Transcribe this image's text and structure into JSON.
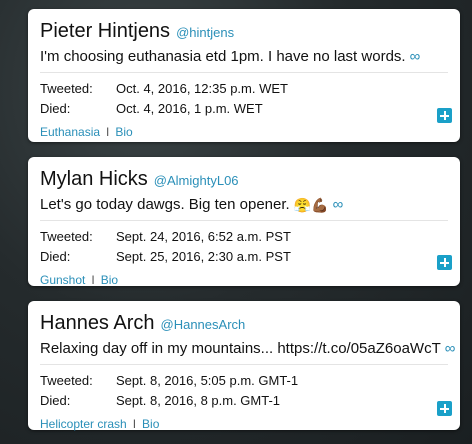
{
  "cards": [
    {
      "name": "Pieter Hintjens",
      "handle": "@hintjens",
      "tweet": "I'm choosing euthanasia etd 1pm. I have no last words.",
      "tweet_icon": "infinity-link-icon",
      "tweeted_label": "Tweeted:",
      "tweeted_value": "Oct. 4, 2016, 12:35 p.m. WET",
      "died_label": "Died:",
      "died_value": "Oct. 4, 2016, 1 p.m. WET",
      "cause": "Euthanasia",
      "separator": "I",
      "bio": "Bio"
    },
    {
      "name": "Mylan Hicks",
      "handle": "@AlmightyL06",
      "tweet": "Let's go today dawgs. Big ten opener.",
      "tweet_emoji": "😤💪🏾",
      "tweet_icon": "infinity-link-icon",
      "tweeted_label": "Tweeted:",
      "tweeted_value": "Sept. 24, 2016, 6:52 a.m. PST",
      "died_label": "Died:",
      "died_value": "Sept. 25, 2016, 2:30 a.m. PST",
      "cause": "Gunshot",
      "separator": "I",
      "bio": "Bio"
    },
    {
      "name": "Hannes Arch",
      "handle": "@HannesArch",
      "tweet": "Relaxing day off in my mountains... https://t.co/05aZ6oaWcT",
      "tweet_icon": "infinity-link-icon",
      "tweeted_label": "Tweeted:",
      "tweeted_value": "Sept. 8, 2016, 5:05 p.m. GMT-1",
      "died_label": "Died:",
      "died_value": "Sept. 8, 2016, 8 p.m. GMT-1",
      "cause": "Helicopter crash",
      "separator": "I",
      "bio": "Bio"
    }
  ],
  "infinity_glyph": "∞",
  "colors": {
    "link": "#2a8fb8",
    "plus_button": "#1aa0c8",
    "background": "#252b2d",
    "card": "#ffffff"
  }
}
